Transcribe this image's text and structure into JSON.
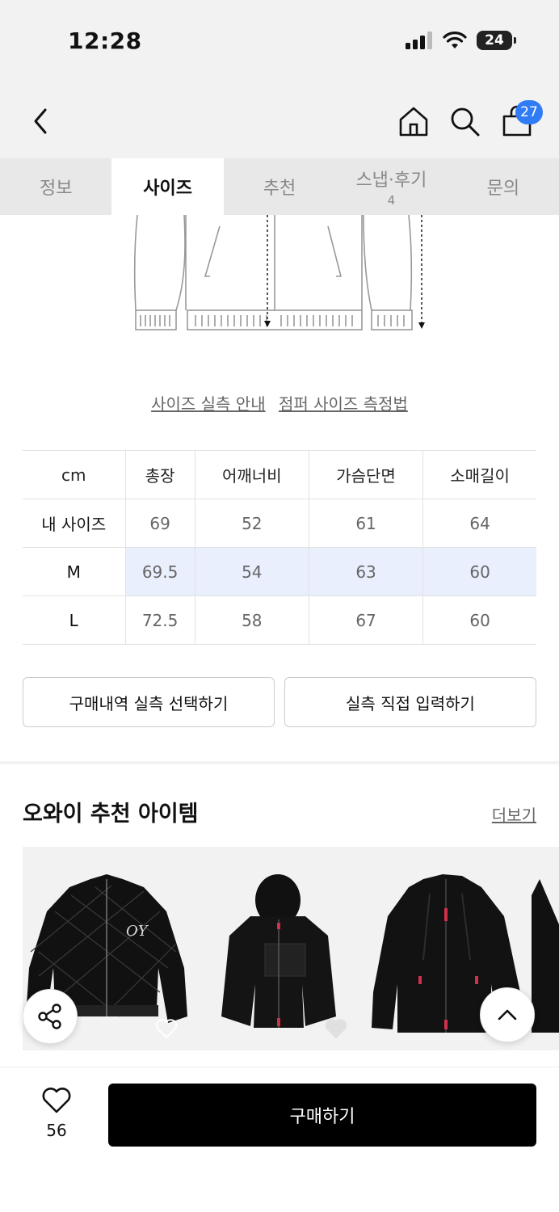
{
  "status_bar": {
    "time": "12:28",
    "battery": "24"
  },
  "header": {
    "cart_count": "27"
  },
  "tabs": [
    {
      "label": "정보",
      "sub": ""
    },
    {
      "label": "사이즈",
      "sub": ""
    },
    {
      "label": "추천",
      "sub": ""
    },
    {
      "label": "스냅·후기",
      "sub": "4"
    },
    {
      "label": "문의",
      "sub": ""
    }
  ],
  "links": {
    "size_guide": "사이즈 실측 안내",
    "measure_method": "점퍼 사이즈 측정법"
  },
  "size_table": {
    "headers": [
      "cm",
      "총장",
      "어깨너비",
      "가슴단면",
      "소매길이"
    ],
    "rows": [
      {
        "label": "내 사이즈",
        "values": [
          "69",
          "52",
          "61",
          "64"
        ]
      },
      {
        "label": "M",
        "values": [
          "69.5",
          "54",
          "63",
          "60"
        ]
      },
      {
        "label": "L",
        "values": [
          "72.5",
          "58",
          "67",
          "60"
        ]
      }
    ]
  },
  "buttons": {
    "purchase_history": "구매내역 실측 선택하기",
    "manual_input": "실측 직접 입력하기"
  },
  "recommend": {
    "title": "오와이 추천 아이템",
    "more": "더보기"
  },
  "bottom": {
    "like_count": "56",
    "buy_label": "구매하기"
  },
  "colors": {
    "accent_blue": "#2f7cf6",
    "highlight_row": "#e9effd",
    "buy_button": "#000000"
  }
}
